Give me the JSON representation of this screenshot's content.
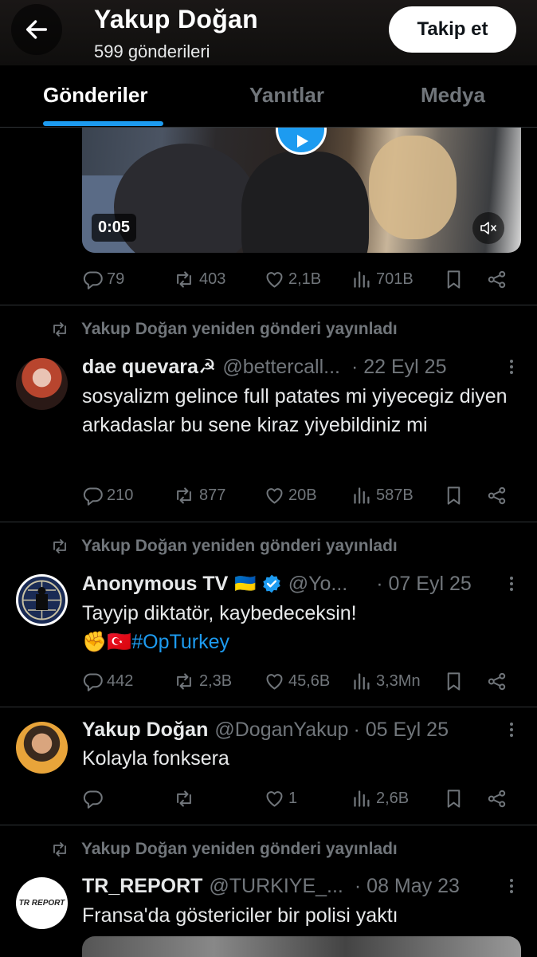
{
  "header": {
    "name": "Yakup Doğan",
    "post_count": "599 gönderileri",
    "follow_label": "Takip et"
  },
  "tabs": [
    {
      "label": "Gönderiler",
      "active": true
    },
    {
      "label": "Yanıtlar",
      "active": false
    },
    {
      "label": "Medya",
      "active": false
    }
  ],
  "video": {
    "duration": "0:05"
  },
  "posts": [
    {
      "stats": {
        "replies": "79",
        "reposts": "403",
        "likes": "2,1B",
        "views": "701B"
      }
    },
    {
      "repost_note": "Yakup Doğan yeniden gönderi yayınladı",
      "name": "dae quevara☭",
      "handle": "@bettercall...",
      "date": "· 22 Eyl 25",
      "text": "sosyalizm gelince full patates mi yiyecegiz diyen arkadaslar bu sene kiraz yiyebildiniz mi",
      "stats": {
        "replies": "210",
        "reposts": "877",
        "likes": "20B",
        "views": "587B"
      }
    },
    {
      "repost_note": "Yakup Doğan yeniden gönderi yayınladı",
      "name": "Anonymous TV",
      "flag": "🇺🇦",
      "handle": "@Yo...",
      "date": "· 07 Eyl 25",
      "text": "Tayyip diktatör, kaybedeceksin!",
      "emoji": "✊🇹🇷",
      "hashtag": "#OpTurkey",
      "stats": {
        "replies": "442",
        "reposts": "2,3B",
        "likes": "45,6B",
        "views": "3,3Mn"
      }
    },
    {
      "name": "Yakup Doğan",
      "handle": "@DoganYakup",
      "date": "· 05 Eyl 25",
      "text": "Kolayla fonksera",
      "stats": {
        "replies": "",
        "reposts": "",
        "likes": "1",
        "views": "2,6B"
      }
    },
    {
      "repost_note": "Yakup Doğan yeniden gönderi yayınladı",
      "name": "TR_REPORT",
      "handle": "@TURKIYE_...",
      "date": "· 08 May 23",
      "text": "Fransa'da göstericiler bir polisi yaktı",
      "avatar_text": "TR REPORT"
    }
  ],
  "colors": {
    "accent": "#1d9bf0",
    "muted": "#71767b",
    "text": "#e7e9ea",
    "background": "#000000"
  }
}
